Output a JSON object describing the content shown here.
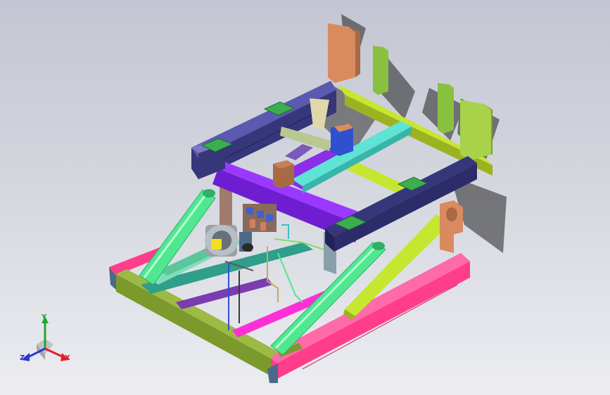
{
  "viewport": {
    "background_top": "#c3c6d2",
    "background_bottom": "#ecedf1"
  },
  "model": {
    "parts": [
      "base-frame",
      "hydraulic-cylinder-left",
      "hydraulic-cylinder-right",
      "scissor-arm-left",
      "scissor-arm-right",
      "top-frame",
      "top-crossbeam",
      "side-beam-rear",
      "end-plates",
      "motor",
      "valve-block",
      "hydraulic-piping"
    ],
    "colors": {
      "base_magenta": "#ff3d8b",
      "base_olive": "#7c9a2c",
      "cylinder": "#4fe890",
      "top_purple": "#9b38ff",
      "navy_beam": "#36367a",
      "yellow_green": "#c6e630",
      "cyan_beam": "#5fe3d5",
      "end_plate": "#d98b5f",
      "pad": "#3cae4f"
    }
  },
  "triad": {
    "x_label": "X",
    "y_label": "Y",
    "z_label": "Z",
    "x_color": "#e0202a",
    "y_color": "#27a52c",
    "z_color": "#2838d8"
  }
}
